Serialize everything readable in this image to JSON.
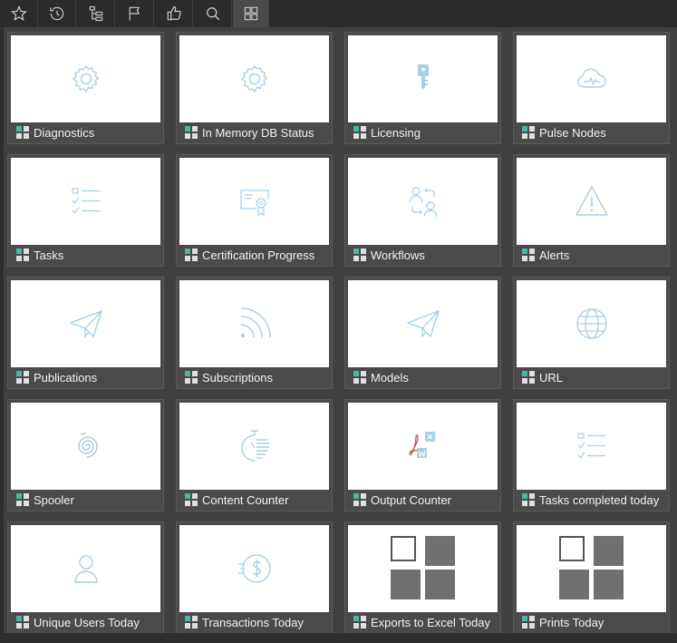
{
  "toolbar": {
    "buttons": [
      {
        "name": "favorites-button",
        "icon": "star-icon"
      },
      {
        "name": "history-button",
        "icon": "history-icon"
      },
      {
        "name": "tree-button",
        "icon": "tree-icon"
      },
      {
        "name": "flag-button",
        "icon": "flag-icon"
      },
      {
        "name": "like-button",
        "icon": "thumbs-up-icon"
      },
      {
        "name": "search-button",
        "icon": "search-icon"
      },
      {
        "name": "tiles-button",
        "icon": "grid-icon",
        "active": true
      }
    ]
  },
  "tiles": [
    {
      "label": "Diagnostics",
      "icon": "gear-icon"
    },
    {
      "label": "In Memory DB Status",
      "icon": "gear-icon"
    },
    {
      "label": "Licensing",
      "icon": "key-icon"
    },
    {
      "label": "Pulse Nodes",
      "icon": "cloud-pulse-icon"
    },
    {
      "label": "Tasks",
      "icon": "checklist-icon"
    },
    {
      "label": "Certification Progress",
      "icon": "certificate-icon"
    },
    {
      "label": "Workflows",
      "icon": "users-swap-icon"
    },
    {
      "label": "Alerts",
      "icon": "warning-icon"
    },
    {
      "label": "Publications",
      "icon": "paper-plane-icon"
    },
    {
      "label": "Subscriptions",
      "icon": "rss-icon"
    },
    {
      "label": "Models",
      "icon": "paper-plane-icon"
    },
    {
      "label": "URL",
      "icon": "globe-icon"
    },
    {
      "label": "Spooler",
      "icon": "spiral-icon"
    },
    {
      "label": "Content Counter",
      "icon": "timer-icon"
    },
    {
      "label": "Output Counter",
      "icon": "document-formats-icon"
    },
    {
      "label": "Tasks completed today",
      "icon": "checklist-icon"
    },
    {
      "label": "Unique Users Today",
      "icon": "user-icon"
    },
    {
      "label": "Transactions Today",
      "icon": "dollar-icon"
    },
    {
      "label": "Exports to Excel Today",
      "icon": "big-grid-icon"
    },
    {
      "label": "Prints Today",
      "icon": "big-grid-icon"
    }
  ],
  "colors": {
    "icon_stroke": "#a9cfe3",
    "label_bar": "#4a4a4a",
    "background": "#404040"
  }
}
